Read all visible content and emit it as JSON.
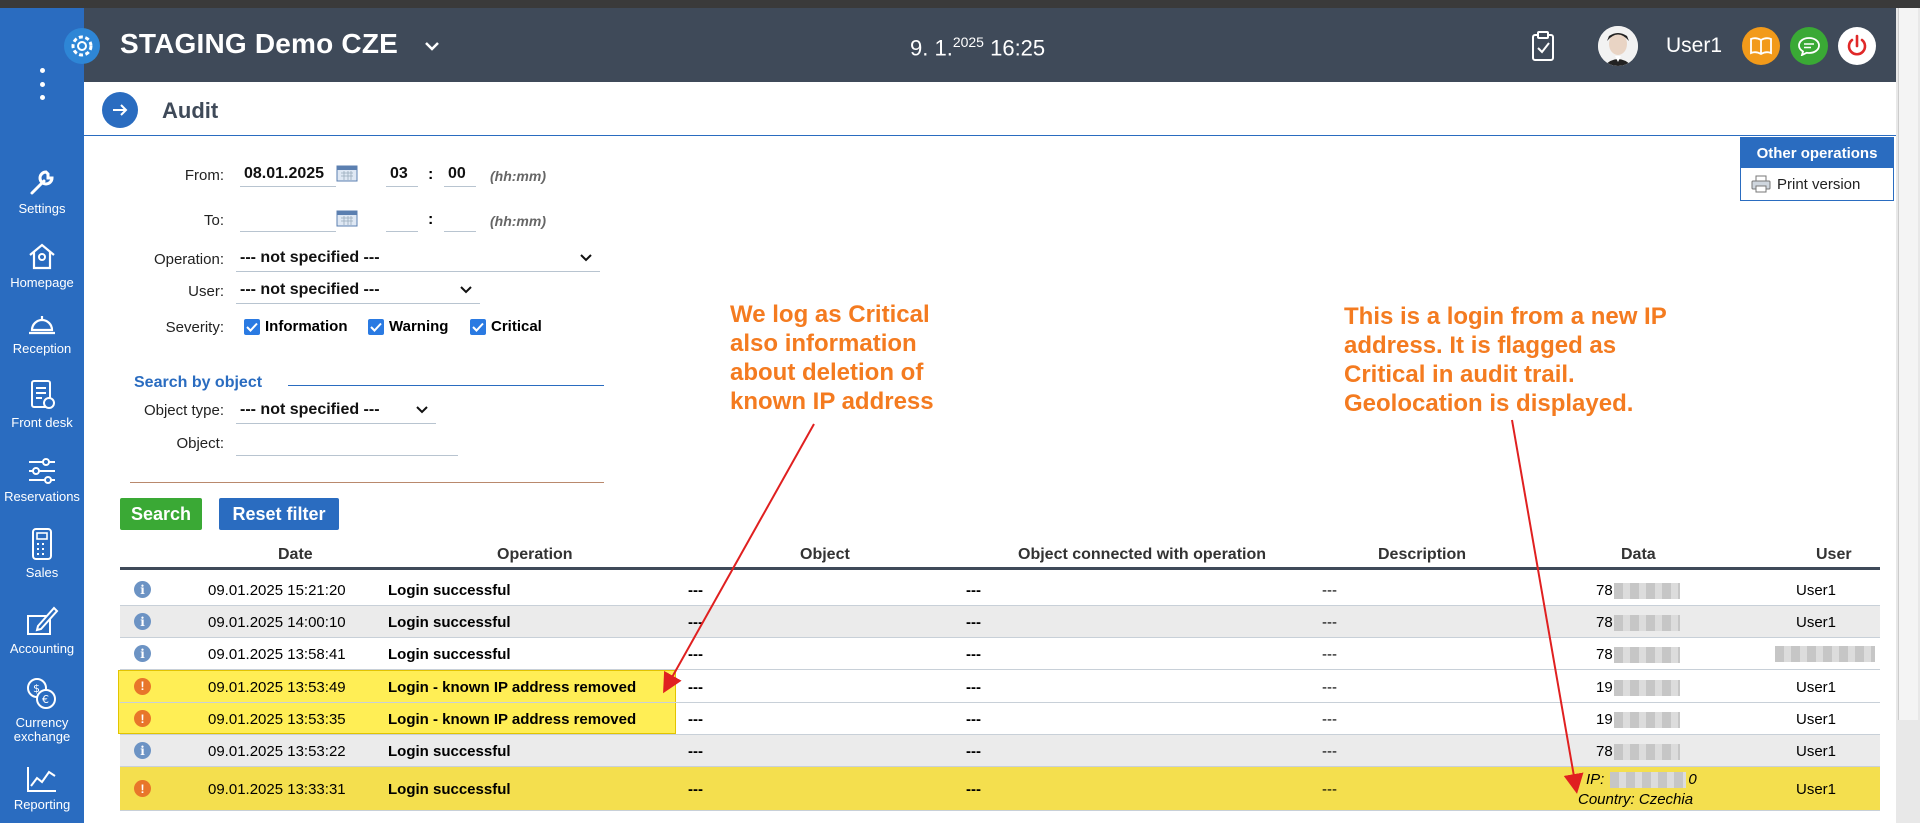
{
  "app": {
    "title": "STAGING Demo CZE",
    "datetime_main": "9. 1.",
    "datetime_year": "2025",
    "datetime_time": "16:25",
    "user": "User1"
  },
  "sidebar": {
    "items": [
      {
        "label": "Settings",
        "icon": "wrench-icon"
      },
      {
        "label": "Homepage",
        "icon": "home-icon"
      },
      {
        "label": "Reception",
        "icon": "bell-icon"
      },
      {
        "label": "Front desk",
        "icon": "clipboard-icon"
      },
      {
        "label": "Reservations",
        "icon": "sliders-icon"
      },
      {
        "label": "Sales",
        "icon": "calculator-icon"
      },
      {
        "label": "Accounting",
        "icon": "pen-icon"
      },
      {
        "label": "Currency exchange",
        "icon": "coins-icon"
      },
      {
        "label": "Reporting",
        "icon": "chart-icon"
      }
    ]
  },
  "page": {
    "title": "Audit"
  },
  "filter": {
    "from_label": "From:",
    "from_date": "08.01.2025",
    "from_hour": "03",
    "from_minute": "00",
    "to_label": "To:",
    "to_date": "",
    "to_hour": "",
    "to_minute": "",
    "hhmm": "(hh:mm)",
    "operation_label": "Operation:",
    "operation_value": "--- not specified ---",
    "user_label": "User:",
    "user_value": "--- not specified ---",
    "severity_label": "Severity:",
    "sev_info": "Information",
    "sev_warning": "Warning",
    "sev_critical": "Critical",
    "object_section": "Search by object",
    "object_type_label": "Object type:",
    "object_type_value": "--- not specified ---",
    "object_label": "Object:",
    "object_value": "",
    "search_button": "Search",
    "reset_button": "Reset filter"
  },
  "other_ops": {
    "title": "Other operations",
    "print": "Print version"
  },
  "annotations": {
    "left": [
      "We log as Critical",
      "also information",
      "about deletion of",
      "known IP address"
    ],
    "right": [
      "This is a login from a new IP",
      "address. It is flagged as",
      "Critical in audit trail.",
      "Geolocation is displayed."
    ]
  },
  "table": {
    "columns": [
      "Date",
      "Operation",
      "Object",
      "Object connected with operation",
      "Description",
      "Data",
      "User"
    ],
    "rows": [
      {
        "severity": "info",
        "date": "09.01.2025 15:21:20",
        "operation": "Login successful",
        "object": "---",
        "connected": "---",
        "description": "---",
        "data": "78",
        "user": "User1"
      },
      {
        "severity": "info",
        "date": "09.01.2025 14:00:10",
        "operation": "Login successful",
        "object": "---",
        "connected": "---",
        "description": "---",
        "data": "78",
        "user": "User1"
      },
      {
        "severity": "info",
        "date": "09.01.2025 13:58:41",
        "operation": "Login successful",
        "object": "---",
        "connected": "---",
        "description": "---",
        "data": "78",
        "user": ""
      },
      {
        "severity": "critical",
        "date": "09.01.2025 13:53:49",
        "operation": "Login - known IP address removed",
        "object": "---",
        "connected": "---",
        "description": "---",
        "data": "19",
        "user": "User1"
      },
      {
        "severity": "critical",
        "date": "09.01.2025 13:53:35",
        "operation": "Login - known IP address removed",
        "object": "---",
        "connected": "---",
        "description": "---",
        "data": "19",
        "user": "User1"
      },
      {
        "severity": "info",
        "date": "09.01.2025 13:53:22",
        "operation": "Login successful",
        "object": "---",
        "connected": "---",
        "description": "---",
        "data": "78",
        "user": "User1"
      },
      {
        "severity": "critical",
        "date": "09.01.2025 13:33:31",
        "operation": "Login successful",
        "object": "---",
        "connected": "---",
        "description": "---",
        "data_ip_label": "IP:",
        "data_ip_suffix": "0",
        "data_country": "Country: Czechia",
        "user": "User1"
      }
    ]
  },
  "colors": {
    "sidebar": "#2a6cc0",
    "header": "#3f4a59",
    "annotation": "#f47b20",
    "highlight": "#f4df4e",
    "arrow": "#e02020"
  }
}
